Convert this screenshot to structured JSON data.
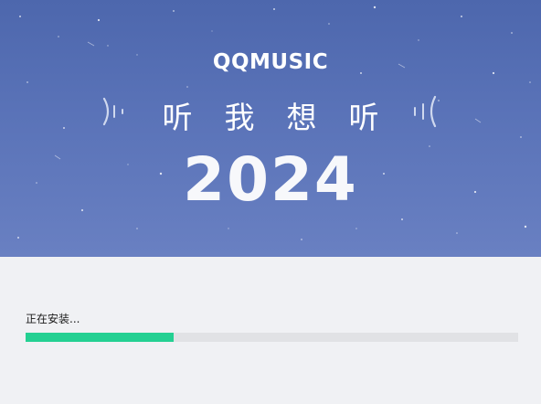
{
  "banner": {
    "logo": "QQMUSIC",
    "slogan": "听我想听",
    "year": "2024"
  },
  "install": {
    "status_text": "正在安装...",
    "progress": 0.3
  },
  "colors": {
    "banner_top": "#4d67ad",
    "banner_bottom": "#6980c2",
    "progress_fill": "#24d092",
    "progress_track": "#e1e2e5",
    "background": "#f0f1f4"
  },
  "icons": {
    "left": "sound-wave-icon",
    "right": "sound-wave-icon"
  }
}
